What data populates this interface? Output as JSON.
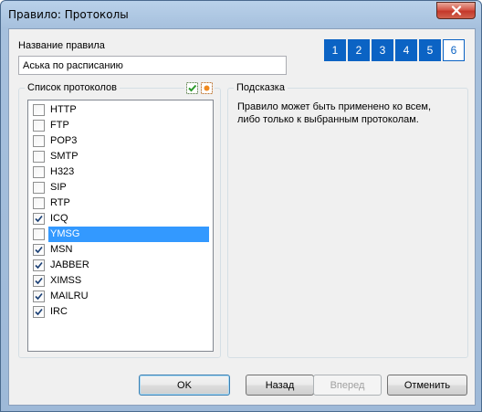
{
  "window": {
    "title": "Правило: Протоколы"
  },
  "form": {
    "rule_name_label": "Название правила",
    "rule_name_value": "Аська по расписанию"
  },
  "steps": [
    "1",
    "2",
    "3",
    "4",
    "5",
    "6"
  ],
  "active_step": "6",
  "protocols": {
    "title": "Список протоколов",
    "icons": [
      "check-all-icon",
      "uncheck-all-icon"
    ],
    "items": [
      {
        "label": "HTTP",
        "checked": false
      },
      {
        "label": "FTP",
        "checked": false
      },
      {
        "label": "POP3",
        "checked": false
      },
      {
        "label": "SMTP",
        "checked": false
      },
      {
        "label": "H323",
        "checked": false
      },
      {
        "label": "SIP",
        "checked": false
      },
      {
        "label": "RTP",
        "checked": false
      },
      {
        "label": "ICQ",
        "checked": true
      },
      {
        "label": "YMSG",
        "checked": false,
        "selected": true
      },
      {
        "label": "MSN",
        "checked": true
      },
      {
        "label": "JABBER",
        "checked": true
      },
      {
        "label": "XIMSS",
        "checked": true
      },
      {
        "label": "MAILRU",
        "checked": true
      },
      {
        "label": "IRC",
        "checked": true
      }
    ]
  },
  "hint": {
    "title": "Подсказка",
    "text": "Правило может быть применено ко всем, либо только к выбранным протоколам."
  },
  "buttons": {
    "ok": "OK",
    "back": "Назад",
    "next": "Вперед",
    "cancel": "Отменить"
  },
  "colors": {
    "accent": "#0b63c4",
    "selection": "#3399ff"
  }
}
